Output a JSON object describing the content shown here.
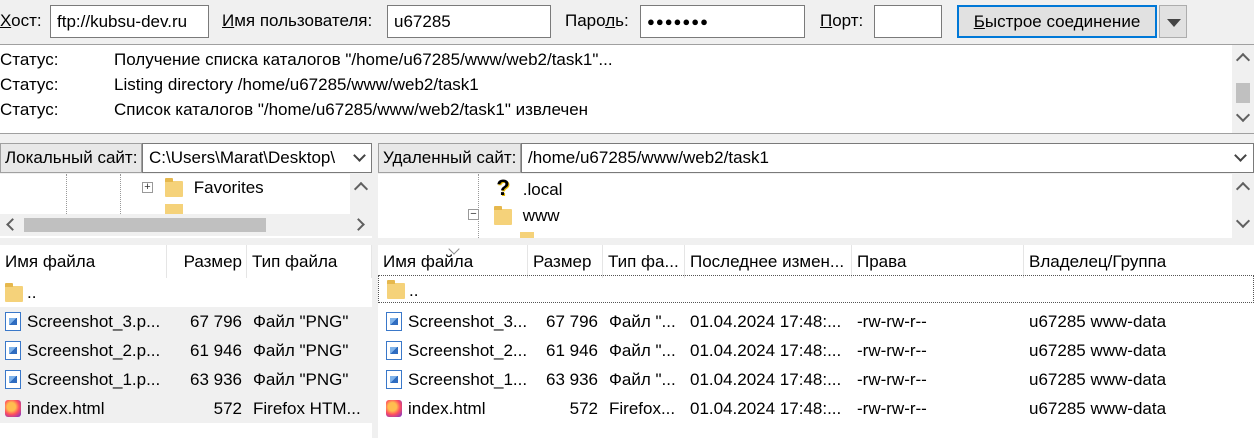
{
  "quickconnect": {
    "host_label_u": "Х",
    "host_label_rest": "ост:",
    "host_value": "ftp://kubsu-dev.ru",
    "user_label_u": "И",
    "user_label_rest": "мя пользователя:",
    "user_value": "u67285",
    "pass_label_rest1": "Паро",
    "pass_label_u": "л",
    "pass_label_rest2": "ь:",
    "pass_value": "●●●●●●●",
    "port_label_u": "П",
    "port_label_rest": "орт:",
    "port_value": "",
    "connect_u": "Б",
    "connect_rest": "ыстрое соединение"
  },
  "log": [
    {
      "status": "Статус:",
      "text": "Получение списка каталогов \"/home/u67285/www/web2/task1\"..."
    },
    {
      "status": "Статус:",
      "text": "Listing directory /home/u67285/www/web2/task1"
    },
    {
      "status": "Статус:",
      "text": "Список каталогов \"/home/u67285/www/web2/task1\" извлечен"
    }
  ],
  "local": {
    "site_label": "Локальный сайт:",
    "path": "C:\\Users\\Marat\\Desktop\\",
    "tree": [
      {
        "label": "Favorites",
        "icon": "folder-star-icon"
      }
    ],
    "columns": [
      "Имя файла",
      "Размер",
      "Тип файла"
    ],
    "files": [
      {
        "name": "..",
        "size": "",
        "type": "",
        "icon": "folder-icon",
        "selected": false
      },
      {
        "name": "Screenshot_3.p...",
        "size": "67 796",
        "type": "Файл \"PNG\"",
        "icon": "png-icon",
        "selected": true
      },
      {
        "name": "Screenshot_2.p...",
        "size": "61 946",
        "type": "Файл \"PNG\"",
        "icon": "png-icon",
        "selected": true
      },
      {
        "name": "Screenshot_1.p...",
        "size": "63 936",
        "type": "Файл \"PNG\"",
        "icon": "png-icon",
        "selected": true
      },
      {
        "name": "index.html",
        "size": "572",
        "type": "Firefox HTM...",
        "icon": "firefox-html-icon",
        "selected": true
      }
    ]
  },
  "remote": {
    "site_label": "Удаленный сайт:",
    "path": "/home/u67285/www/web2/task1",
    "tree": [
      {
        "label": ".local",
        "icon": "question-icon"
      },
      {
        "label": "www",
        "icon": "folder-icon"
      }
    ],
    "columns": [
      "Имя файла",
      "Размер",
      "Тип фа...",
      "Последнее измен...",
      "Права",
      "Владелец/Группа"
    ],
    "files": [
      {
        "name": "..",
        "size": "",
        "type": "",
        "modified": "",
        "perms": "",
        "owner": "",
        "icon": "folder-icon"
      },
      {
        "name": "Screenshot_3...",
        "size": "67 796",
        "type": "Файл \"...",
        "modified": "01.04.2024 17:48:...",
        "perms": "-rw-rw-r--",
        "owner": "u67285 www-data",
        "icon": "png-icon"
      },
      {
        "name": "Screenshot_2...",
        "size": "61 946",
        "type": "Файл \"...",
        "modified": "01.04.2024 17:48:...",
        "perms": "-rw-rw-r--",
        "owner": "u67285 www-data",
        "icon": "png-icon"
      },
      {
        "name": "Screenshot_1...",
        "size": "63 936",
        "type": "Файл \"...",
        "modified": "01.04.2024 17:48:...",
        "perms": "-rw-rw-r--",
        "owner": "u67285 www-data",
        "icon": "png-icon"
      },
      {
        "name": "index.html",
        "size": "572",
        "type": "Firefox...",
        "modified": "01.04.2024 17:48:...",
        "perms": "-rw-rw-r--",
        "owner": "u67285 www-data",
        "icon": "firefox-html-icon"
      }
    ]
  }
}
